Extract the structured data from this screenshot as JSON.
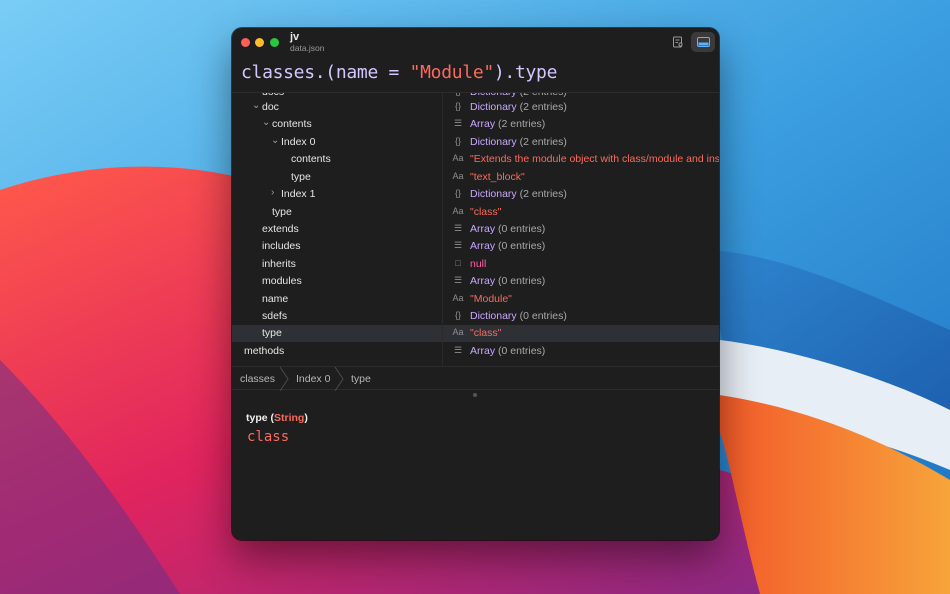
{
  "window": {
    "title": "jv",
    "subtitle": "data.json"
  },
  "toolbar": {
    "inspector_icon": "inspector-icon",
    "panel_icon": "bottom-panel-icon"
  },
  "query": {
    "part1": "classes.(name = ",
    "part2": "\"Module\"",
    "part3": ").type"
  },
  "tree": {
    "rows": [
      {
        "key": "docs",
        "chevron": "",
        "type_icon": "{}",
        "type": "Dictionary",
        "count": "(2 entries)",
        "kind": "dict",
        "clipped": true
      },
      {
        "key": "doc",
        "chevron": "⌄",
        "type_icon": "{}",
        "type": "Dictionary",
        "count": "(2 entries)",
        "kind": "dict"
      },
      {
        "key": "contents",
        "chevron": "⌄",
        "type_icon": "☰",
        "type": "Array",
        "count": "(2 entries)",
        "kind": "array"
      },
      {
        "key": "Index 0",
        "chevron": "⌄",
        "type_icon": "{}",
        "type": "Dictionary",
        "count": "(2 entries)",
        "kind": "dict"
      },
      {
        "key": "contents",
        "chevron": "",
        "type_icon": "Aa",
        "value": "\"Extends the module object with class/module and instar",
        "kind": "string"
      },
      {
        "key": "type",
        "chevron": "",
        "type_icon": "Aa",
        "value": "\"text_block\"",
        "kind": "string"
      },
      {
        "key": "Index 1",
        "chevron": "›",
        "type_icon": "{}",
        "type": "Dictionary",
        "count": "(2 entries)",
        "kind": "dict"
      },
      {
        "key": "type",
        "chevron": "",
        "type_icon": "Aa",
        "value": "\"class\"",
        "kind": "string"
      },
      {
        "key": "extends",
        "chevron": "",
        "type_icon": "☰",
        "type": "Array",
        "count": "(0 entries)",
        "kind": "array"
      },
      {
        "key": "includes",
        "chevron": "",
        "type_icon": "☰",
        "type": "Array",
        "count": "(0 entries)",
        "kind": "array"
      },
      {
        "key": "inherits",
        "chevron": "",
        "type_icon": "□",
        "value": "null",
        "kind": "null"
      },
      {
        "key": "modules",
        "chevron": "",
        "type_icon": "☰",
        "type": "Array",
        "count": "(0 entries)",
        "kind": "array"
      },
      {
        "key": "name",
        "chevron": "",
        "type_icon": "Aa",
        "value": "\"Module\"",
        "kind": "string"
      },
      {
        "key": "sdefs",
        "chevron": "",
        "type_icon": "{}",
        "type": "Dictionary",
        "count": "(0 entries)",
        "kind": "dict"
      },
      {
        "key": "type",
        "chevron": "",
        "type_icon": "Aa",
        "value": "\"class\"",
        "kind": "string",
        "selected": true
      },
      {
        "key": "methods",
        "chevron": "",
        "type_icon": "☰",
        "type": "Array",
        "count": "(0 entries)",
        "kind": "array"
      }
    ]
  },
  "breadcrumb": {
    "items": [
      "classes",
      "Index 0",
      "type"
    ]
  },
  "detail": {
    "key": "type",
    "open_paren": " (",
    "type": "String",
    "close_paren": ")",
    "value": "class"
  },
  "colors": {
    "accent_type": "#c9a8ff",
    "string": "#fc6a5d",
    "null": "#fc5fa3"
  }
}
